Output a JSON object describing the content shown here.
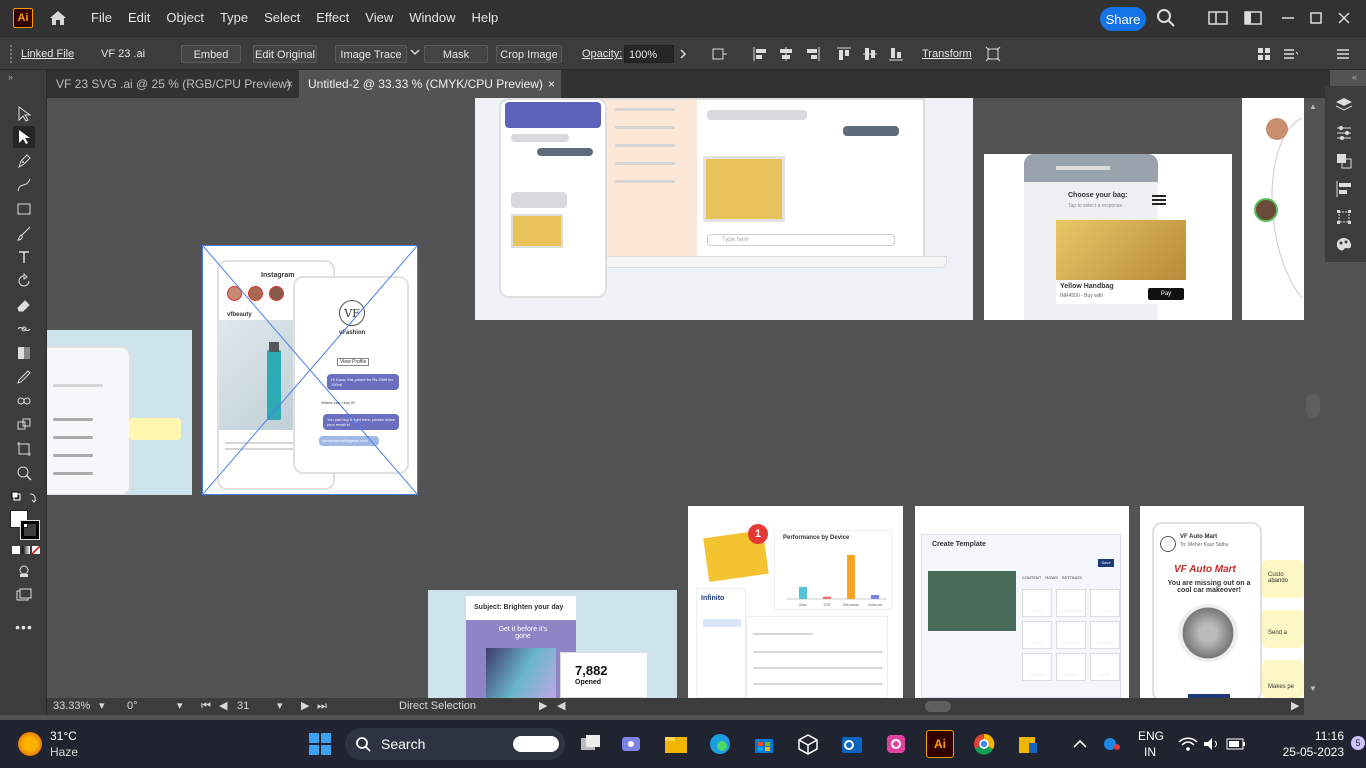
{
  "app": {
    "logo": "Ai",
    "menu": [
      "File",
      "Edit",
      "Object",
      "Type",
      "Select",
      "Effect",
      "View",
      "Window",
      "Help"
    ],
    "share_label": "Share"
  },
  "control_bar": {
    "linked_file": "Linked File",
    "file_name": "VF 23 .ai",
    "embed": "Embed",
    "edit_original": "Edit Original",
    "image_trace": "Image Trace",
    "mask": "Mask",
    "crop_image": "Crop Image",
    "opacity_label": "Opacity:",
    "opacity_value": "100%",
    "transform": "Transform"
  },
  "tabs": [
    {
      "label": "VF 23 SVG .ai @ 25 % (RGB/CPU Preview)",
      "close": "×"
    },
    {
      "label": "Untitled-2 @ 33.33 % (CMYK/CPU Preview)",
      "close": "×"
    }
  ],
  "canvas": {
    "bag_prompt": "Choose your bag:",
    "bag_sub": "Tap to select a response",
    "bag_title": "Yellow Handbag",
    "bag_price": "INR4500 - Buy with",
    "pay_label": "Pay",
    "instagram": "Instagram",
    "vf_brand": "VF",
    "beauty": "Beauty",
    "insta_handle": "vfbeauty",
    "insta_profile": "vFashion",
    "view_profile": "View Profile",
    "insta_msg1": "Hi Kasa, this priced for Rs.2599 for 100ml",
    "insta_msg2": "Where can I buy it?",
    "insta_msg3": "You can buy it right here, please share your email id",
    "insta_email": "kanakhotmail@gmail.com",
    "email_subject": "Subject: Brighten your day",
    "email_get": "Get it before it's gone",
    "opened_value": "7,882",
    "opened_label": "Opened",
    "perf_title": "Performance by Device",
    "perf_categories": [
      "Mac",
      "iOS",
      "Windows",
      "Android"
    ],
    "perf_values": [
      15,
      3,
      55,
      5
    ],
    "template_title": "Create Template",
    "template_save": "Save",
    "template_tabs": [
      "CONTENT",
      "ROWS",
      "SETTINGS"
    ],
    "template_items": [
      "TITLE",
      "PARAGRAPH",
      "TITLE",
      "TITLE",
      "BUTTON",
      "DIVIDER",
      "SPACER",
      "SOCIAL",
      "HTML"
    ],
    "automart_from": "VF Auto Mart",
    "automart_to": "To: Meher Kaur Sidhu",
    "automart_title": "VF Auto Mart",
    "automart_body": "You are missing out on a cool car makeover!",
    "automart_side1": "Custo abando",
    "automart_side2": "Send a",
    "automart_side3": "Makes pe",
    "infinito": "Infinito",
    "notif_count": "1",
    "reply_placeholder": "Type here"
  },
  "status_bar": {
    "zoom": "33.33%",
    "rotation": "0°",
    "artboard": "31",
    "tool": "Direct Selection"
  },
  "taskbar": {
    "weather_temp": "31°C",
    "weather_desc": "Haze",
    "search_label": "Search",
    "lang1": "ENG",
    "lang2": "IN",
    "time": "11:16",
    "date": "25-05-2023",
    "notification_count": "5"
  }
}
